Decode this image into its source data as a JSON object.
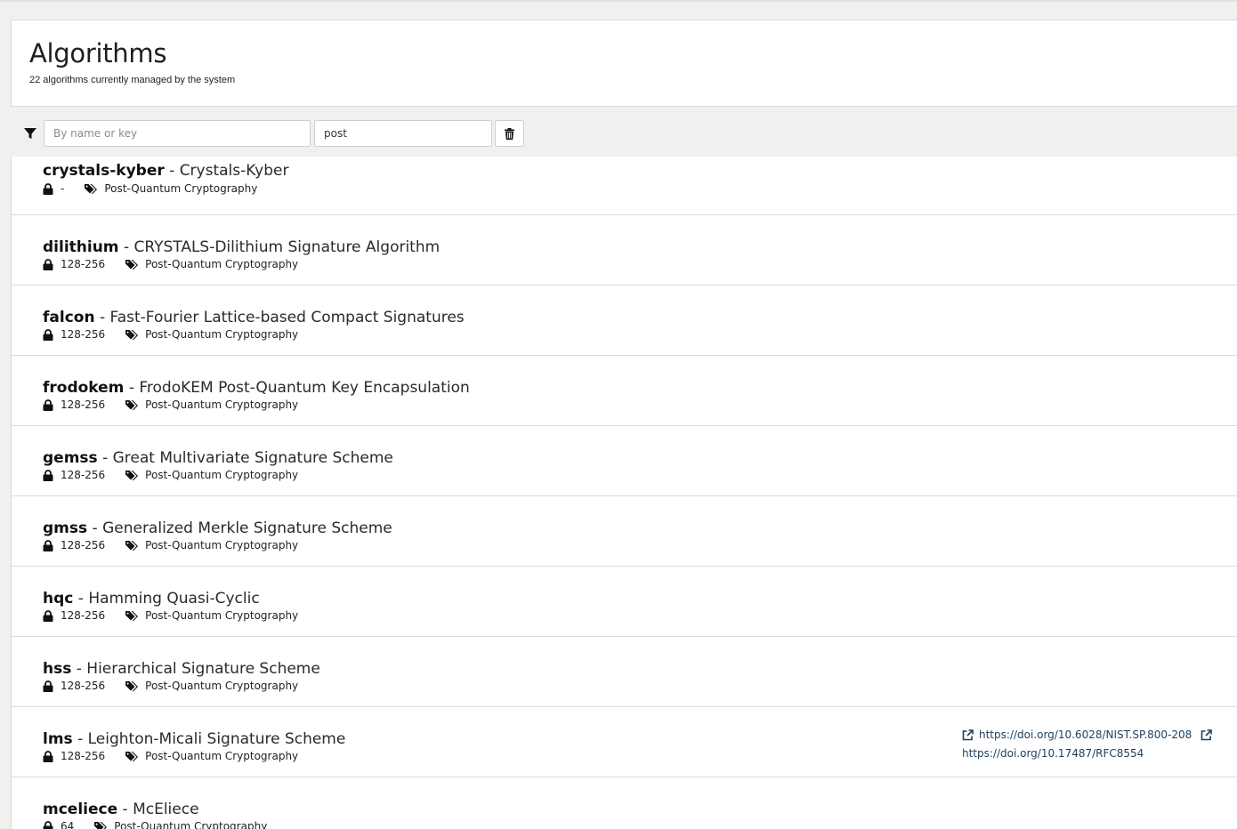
{
  "header": {
    "title": "Algorithms",
    "subtitle": "22 algorithms currently managed by the system"
  },
  "filter": {
    "name_placeholder": "By name or key",
    "name_value": "",
    "tag_value": "post"
  },
  "items": [
    {
      "key": "crystals-kyber",
      "name": "Crystals-Kyber",
      "strength": "-",
      "tags": "Post-Quantum Cryptography"
    },
    {
      "key": "dilithium",
      "name": "CRYSTALS-Dilithium Signature Algorithm",
      "strength": "128-256",
      "tags": "Post-Quantum Cryptography"
    },
    {
      "key": "falcon",
      "name": "Fast-Fourier Lattice-based Compact Signatures",
      "strength": "128-256",
      "tags": "Post-Quantum Cryptography"
    },
    {
      "key": "frodokem",
      "name": "FrodoKEM Post-Quantum Key Encapsulation",
      "strength": "128-256",
      "tags": "Post-Quantum Cryptography"
    },
    {
      "key": "gemss",
      "name": "Great Multivariate Signature Scheme",
      "strength": "128-256",
      "tags": "Post-Quantum Cryptography"
    },
    {
      "key": "gmss",
      "name": "Generalized Merkle Signature Scheme",
      "strength": "128-256",
      "tags": "Post-Quantum Cryptography"
    },
    {
      "key": "hqc",
      "name": "Hamming Quasi-Cyclic",
      "strength": "128-256",
      "tags": "Post-Quantum Cryptography"
    },
    {
      "key": "hss",
      "name": "Hierarchical Signature Scheme",
      "strength": "128-256",
      "tags": "Post-Quantum Cryptography"
    },
    {
      "key": "lms",
      "name": "Leighton-Micali Signature Scheme",
      "strength": "128-256",
      "tags": "Post-Quantum Cryptography",
      "refs": [
        "https://doi.org/10.6028/NIST.SP.800-208",
        "https://doi.org/10.17487/RFC8554"
      ]
    },
    {
      "key": "mceliece",
      "name": "McEliece",
      "strength": "64",
      "tags": "Post-Quantum Cryptography"
    }
  ],
  "separator": "-",
  "icons": {
    "filter": "filter-icon",
    "clear": "trash-icon",
    "strength": "lock-icon",
    "tags": "tags-icon",
    "link": "external-link-icon"
  },
  "colors": {
    "link": "#1b3f5f",
    "background": "#f0f0ef"
  }
}
